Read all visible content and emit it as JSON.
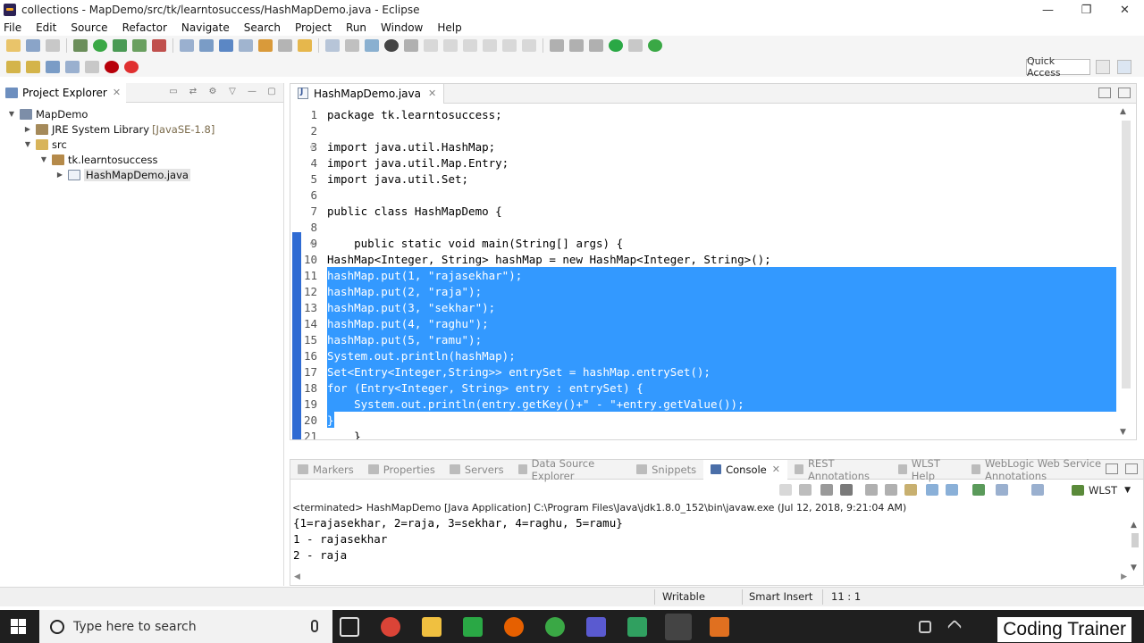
{
  "window": {
    "title": "collections - MapDemo/src/tk/learntosuccess/HashMapDemo.java - Eclipse",
    "controls": {
      "minimize": "—",
      "restore": "❐",
      "close": "✕"
    }
  },
  "menu": [
    "File",
    "Edit",
    "Source",
    "Refactor",
    "Navigate",
    "Search",
    "Project",
    "Run",
    "Window",
    "Help"
  ],
  "toolbar": {
    "quick_access": "Quick Access"
  },
  "explorer": {
    "tab_label": "Project Explorer",
    "close": "✕",
    "tree": [
      {
        "label": "MapDemo",
        "decoration": ""
      },
      {
        "label": "JRE System Library",
        "decoration": "[JavaSE-1.8]"
      },
      {
        "label": "src",
        "decoration": ""
      },
      {
        "label": "tk.learntosuccess",
        "decoration": ""
      },
      {
        "label": "HashMapDemo.java",
        "decoration": ""
      }
    ]
  },
  "editor": {
    "tab_label": "HashMapDemo.java",
    "close": "✕",
    "lines": [
      {
        "n": "1",
        "text": "package tk.learntosuccess;"
      },
      {
        "n": "2",
        "text": ""
      },
      {
        "n": "3",
        "text": "import java.util.HashMap;"
      },
      {
        "n": "4",
        "text": "import java.util.Map.Entry;"
      },
      {
        "n": "5",
        "text": "import java.util.Set;"
      },
      {
        "n": "6",
        "text": ""
      },
      {
        "n": "7",
        "text": "public class HashMapDemo {"
      },
      {
        "n": "8",
        "text": ""
      },
      {
        "n": "9",
        "text": "    public static void main(String[] args) {"
      },
      {
        "n": "10",
        "text": "HashMap<Integer, String> hashMap = new HashMap<Integer, String>();"
      },
      {
        "n": "11",
        "text": "hashMap.put(1, \"rajasekhar\");"
      },
      {
        "n": "12",
        "text": "hashMap.put(2, \"raja\");"
      },
      {
        "n": "13",
        "text": "hashMap.put(3, \"sekhar\");"
      },
      {
        "n": "14",
        "text": "hashMap.put(4, \"raghu\");"
      },
      {
        "n": "15",
        "text": "hashMap.put(5, \"ramu\");"
      },
      {
        "n": "16",
        "text": "System.out.println(hashMap);"
      },
      {
        "n": "17",
        "text": "Set<Entry<Integer,String>> entrySet = hashMap.entrySet();"
      },
      {
        "n": "18",
        "text": "for (Entry<Integer, String> entry : entrySet) {"
      },
      {
        "n": "19",
        "text": "    System.out.println(entry.getKey()+\" - \"+entry.getValue());"
      },
      {
        "n": "20",
        "text": "}"
      },
      {
        "n": "21",
        "text": "    }"
      }
    ]
  },
  "bottom_panel": {
    "tabs": [
      "Markers",
      "Properties",
      "Servers",
      "Data Source Explorer",
      "Snippets",
      "Console",
      "REST Annotations",
      "WLST Help",
      "WebLogic Web Service Annotations"
    ],
    "active_tab": "Console",
    "close": "✕",
    "wlst_label": "WLST",
    "terminated": "<terminated> HashMapDemo [Java Application] C:\\Program Files\\Java\\jdk1.8.0_152\\bin\\javaw.exe (Jul 12, 2018, 9:21:04 AM)",
    "output": [
      "{1=rajasekhar, 2=raja, 3=sekhar, 4=raghu, 5=ramu}",
      "1 - rajasekhar",
      "2 - raja"
    ]
  },
  "status": {
    "writable": "Writable",
    "insert_mode": "Smart Insert",
    "position": "11 : 1"
  },
  "taskbar": {
    "search_placeholder": "Type here to search",
    "overlay": "Coding Trainer"
  }
}
